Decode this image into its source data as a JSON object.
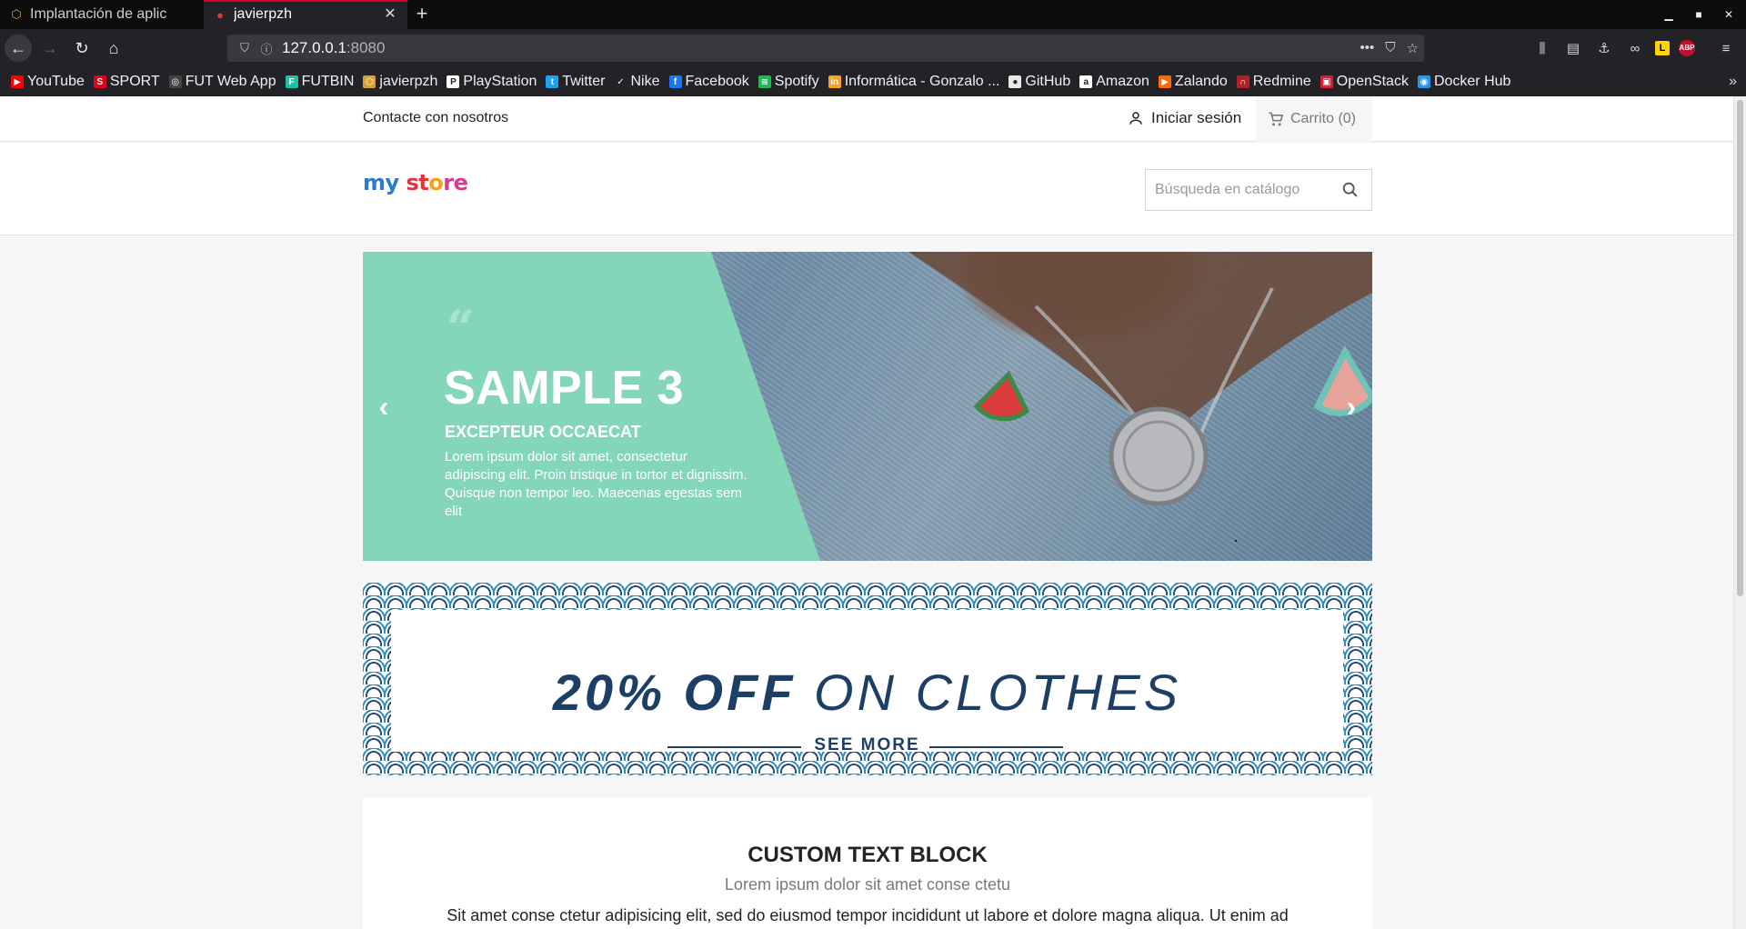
{
  "browser": {
    "tabs": [
      {
        "label": "Implantación de aplic",
        "icon": "bundle-icon",
        "active": false
      },
      {
        "label": "javierpzh",
        "icon": "raspberry-icon",
        "active": true
      }
    ],
    "url_host": "127.0.0.1",
    "url_port": ":8080",
    "bookmarks": [
      {
        "label": "YouTube",
        "color": "#ff0000",
        "glyph": "▶"
      },
      {
        "label": "SPORT",
        "color": "#e2001a",
        "glyph": "S"
      },
      {
        "label": "FUT Web App",
        "color": "#444444",
        "glyph": "◎"
      },
      {
        "label": "FUTBIN",
        "color": "#1cc2a5",
        "glyph": "F"
      },
      {
        "label": "javierpzh",
        "color": "#d6a33a",
        "glyph": "⬡"
      },
      {
        "label": "PlayStation",
        "color": "#ffffff",
        "glyph": "P"
      },
      {
        "label": "Twitter",
        "color": "#1da1f2",
        "glyph": "t"
      },
      {
        "label": "Nike",
        "color": "#232327",
        "glyph": "✓"
      },
      {
        "label": "Facebook",
        "color": "#1877f2",
        "glyph": "f"
      },
      {
        "label": "Spotify",
        "color": "#1db954",
        "glyph": "≋"
      },
      {
        "label": "Informática - Gonzalo ...",
        "color": "#f7a21b",
        "glyph": "in"
      },
      {
        "label": "GitHub",
        "color": "#e8e8e8",
        "glyph": "●"
      },
      {
        "label": "Amazon",
        "color": "#ffffff",
        "glyph": "a"
      },
      {
        "label": "Zalando",
        "color": "#ff6900",
        "glyph": "▶"
      },
      {
        "label": "Redmine",
        "color": "#b32024",
        "glyph": "∩"
      },
      {
        "label": "OpenStack",
        "color": "#da1a32",
        "glyph": "▣"
      },
      {
        "label": "Docker Hub",
        "color": "#2496ed",
        "glyph": "◉"
      }
    ]
  },
  "store": {
    "contact": "Contacte con nosotros",
    "signin": "Iniciar sesión",
    "cart": "Carrito (0)",
    "logo": [
      "my",
      " ",
      "st",
      "o",
      "re"
    ],
    "search_placeholder": "Búsqueda en catálogo",
    "slide": {
      "title": "SAMPLE 3",
      "subtitle": "EXCEPTEUR OCCAECAT",
      "body": "Lorem ipsum dolor sit amet, consectetur adipiscing elit. Proin tristique in tortor et dignissim. Quisque non tempor leo. Maecenas egestas sem elit"
    },
    "banner": {
      "bold": "20% OFF",
      "rest": " ON CLOTHES",
      "more": "SEE MORE"
    },
    "custom_text": {
      "title": "CUSTOM TEXT BLOCK",
      "subtitle": "Lorem ipsum dolor sit amet conse ctetu",
      "body": "Sit amet conse ctetur adipisicing elit, sed do eiusmod tempor incididunt ut labore et dolore magna aliqua. Ut enim ad"
    }
  }
}
